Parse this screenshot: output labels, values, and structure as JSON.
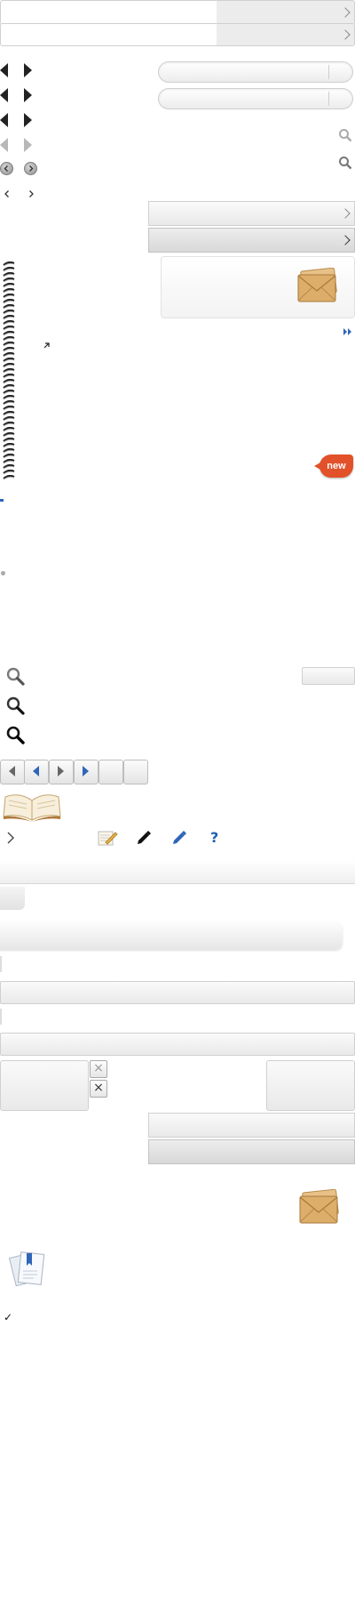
{
  "badges": {
    "new_label": "new"
  },
  "help": {
    "glyph": "?"
  },
  "close": {
    "glyph": "×"
  },
  "check": {
    "glyph": "✓"
  },
  "colors": {
    "accent_blue": "#2f66b8",
    "badge_orange": "#e2512a",
    "envelope": "#d9a860",
    "border": "#d0d0d0"
  },
  "icons": [
    "chevron-right-icon",
    "triangle-left-icon",
    "triangle-right-icon",
    "round-left-icon",
    "round-right-icon",
    "search-icon",
    "envelope-icon",
    "double-chevron-icon",
    "external-arrow-icon",
    "spiral-binding-icon",
    "open-book-icon",
    "note-pencil-icon",
    "pencil-icon",
    "help-icon",
    "close-icon",
    "checkmark-icon",
    "documents-icon"
  ]
}
